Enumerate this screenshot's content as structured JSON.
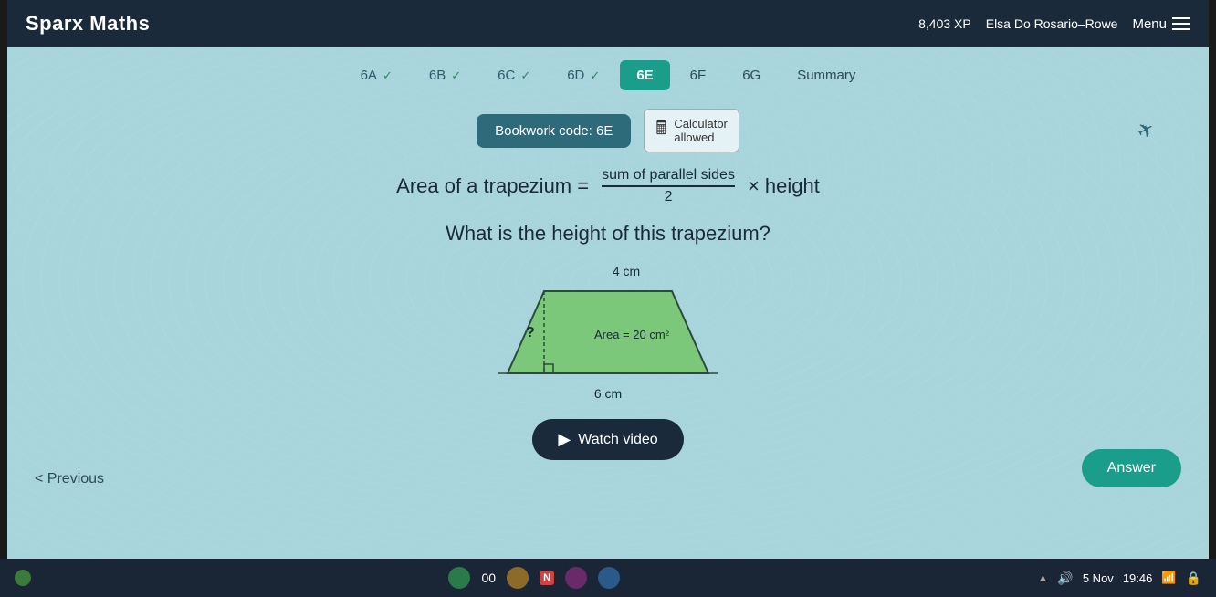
{
  "app": {
    "title": "Sparx Maths",
    "xp": "8,403 XP",
    "user": "Elsa Do Rosario–Rowe",
    "menu_label": "Menu"
  },
  "tabs": [
    {
      "id": "6A",
      "label": "6A",
      "state": "completed",
      "check": "✓"
    },
    {
      "id": "6B",
      "label": "6B",
      "state": "completed",
      "check": "✓"
    },
    {
      "id": "6C",
      "label": "6C",
      "state": "completed",
      "check": "✓"
    },
    {
      "id": "6D",
      "label": "6D",
      "state": "completed",
      "check": "✓"
    },
    {
      "id": "6E",
      "label": "6E",
      "state": "active"
    },
    {
      "id": "6F",
      "label": "6F",
      "state": "plain"
    },
    {
      "id": "6G",
      "label": "6G",
      "state": "plain"
    },
    {
      "id": "Summary",
      "label": "Summary",
      "state": "plain"
    }
  ],
  "bookwork": {
    "label": "Bookwork code: 6E",
    "calculator_line1": "Calculator",
    "calculator_line2": "allowed"
  },
  "formula": {
    "prefix": "Area of a trapezium =",
    "numerator": "sum of parallel sides",
    "denominator": "2",
    "suffix": "× height"
  },
  "question": {
    "text": "What is the height of this trapezium?"
  },
  "diagram": {
    "top_label": "4 cm",
    "bottom_label": "6 cm",
    "height_label": "?",
    "area_label": "Area = 20 cm²"
  },
  "buttons": {
    "watch_video": "Watch video",
    "previous": "< Previous",
    "answer": "Answer"
  },
  "taskbar": {
    "time": "19:46",
    "date": "5 Nov",
    "clock_display": "00"
  }
}
